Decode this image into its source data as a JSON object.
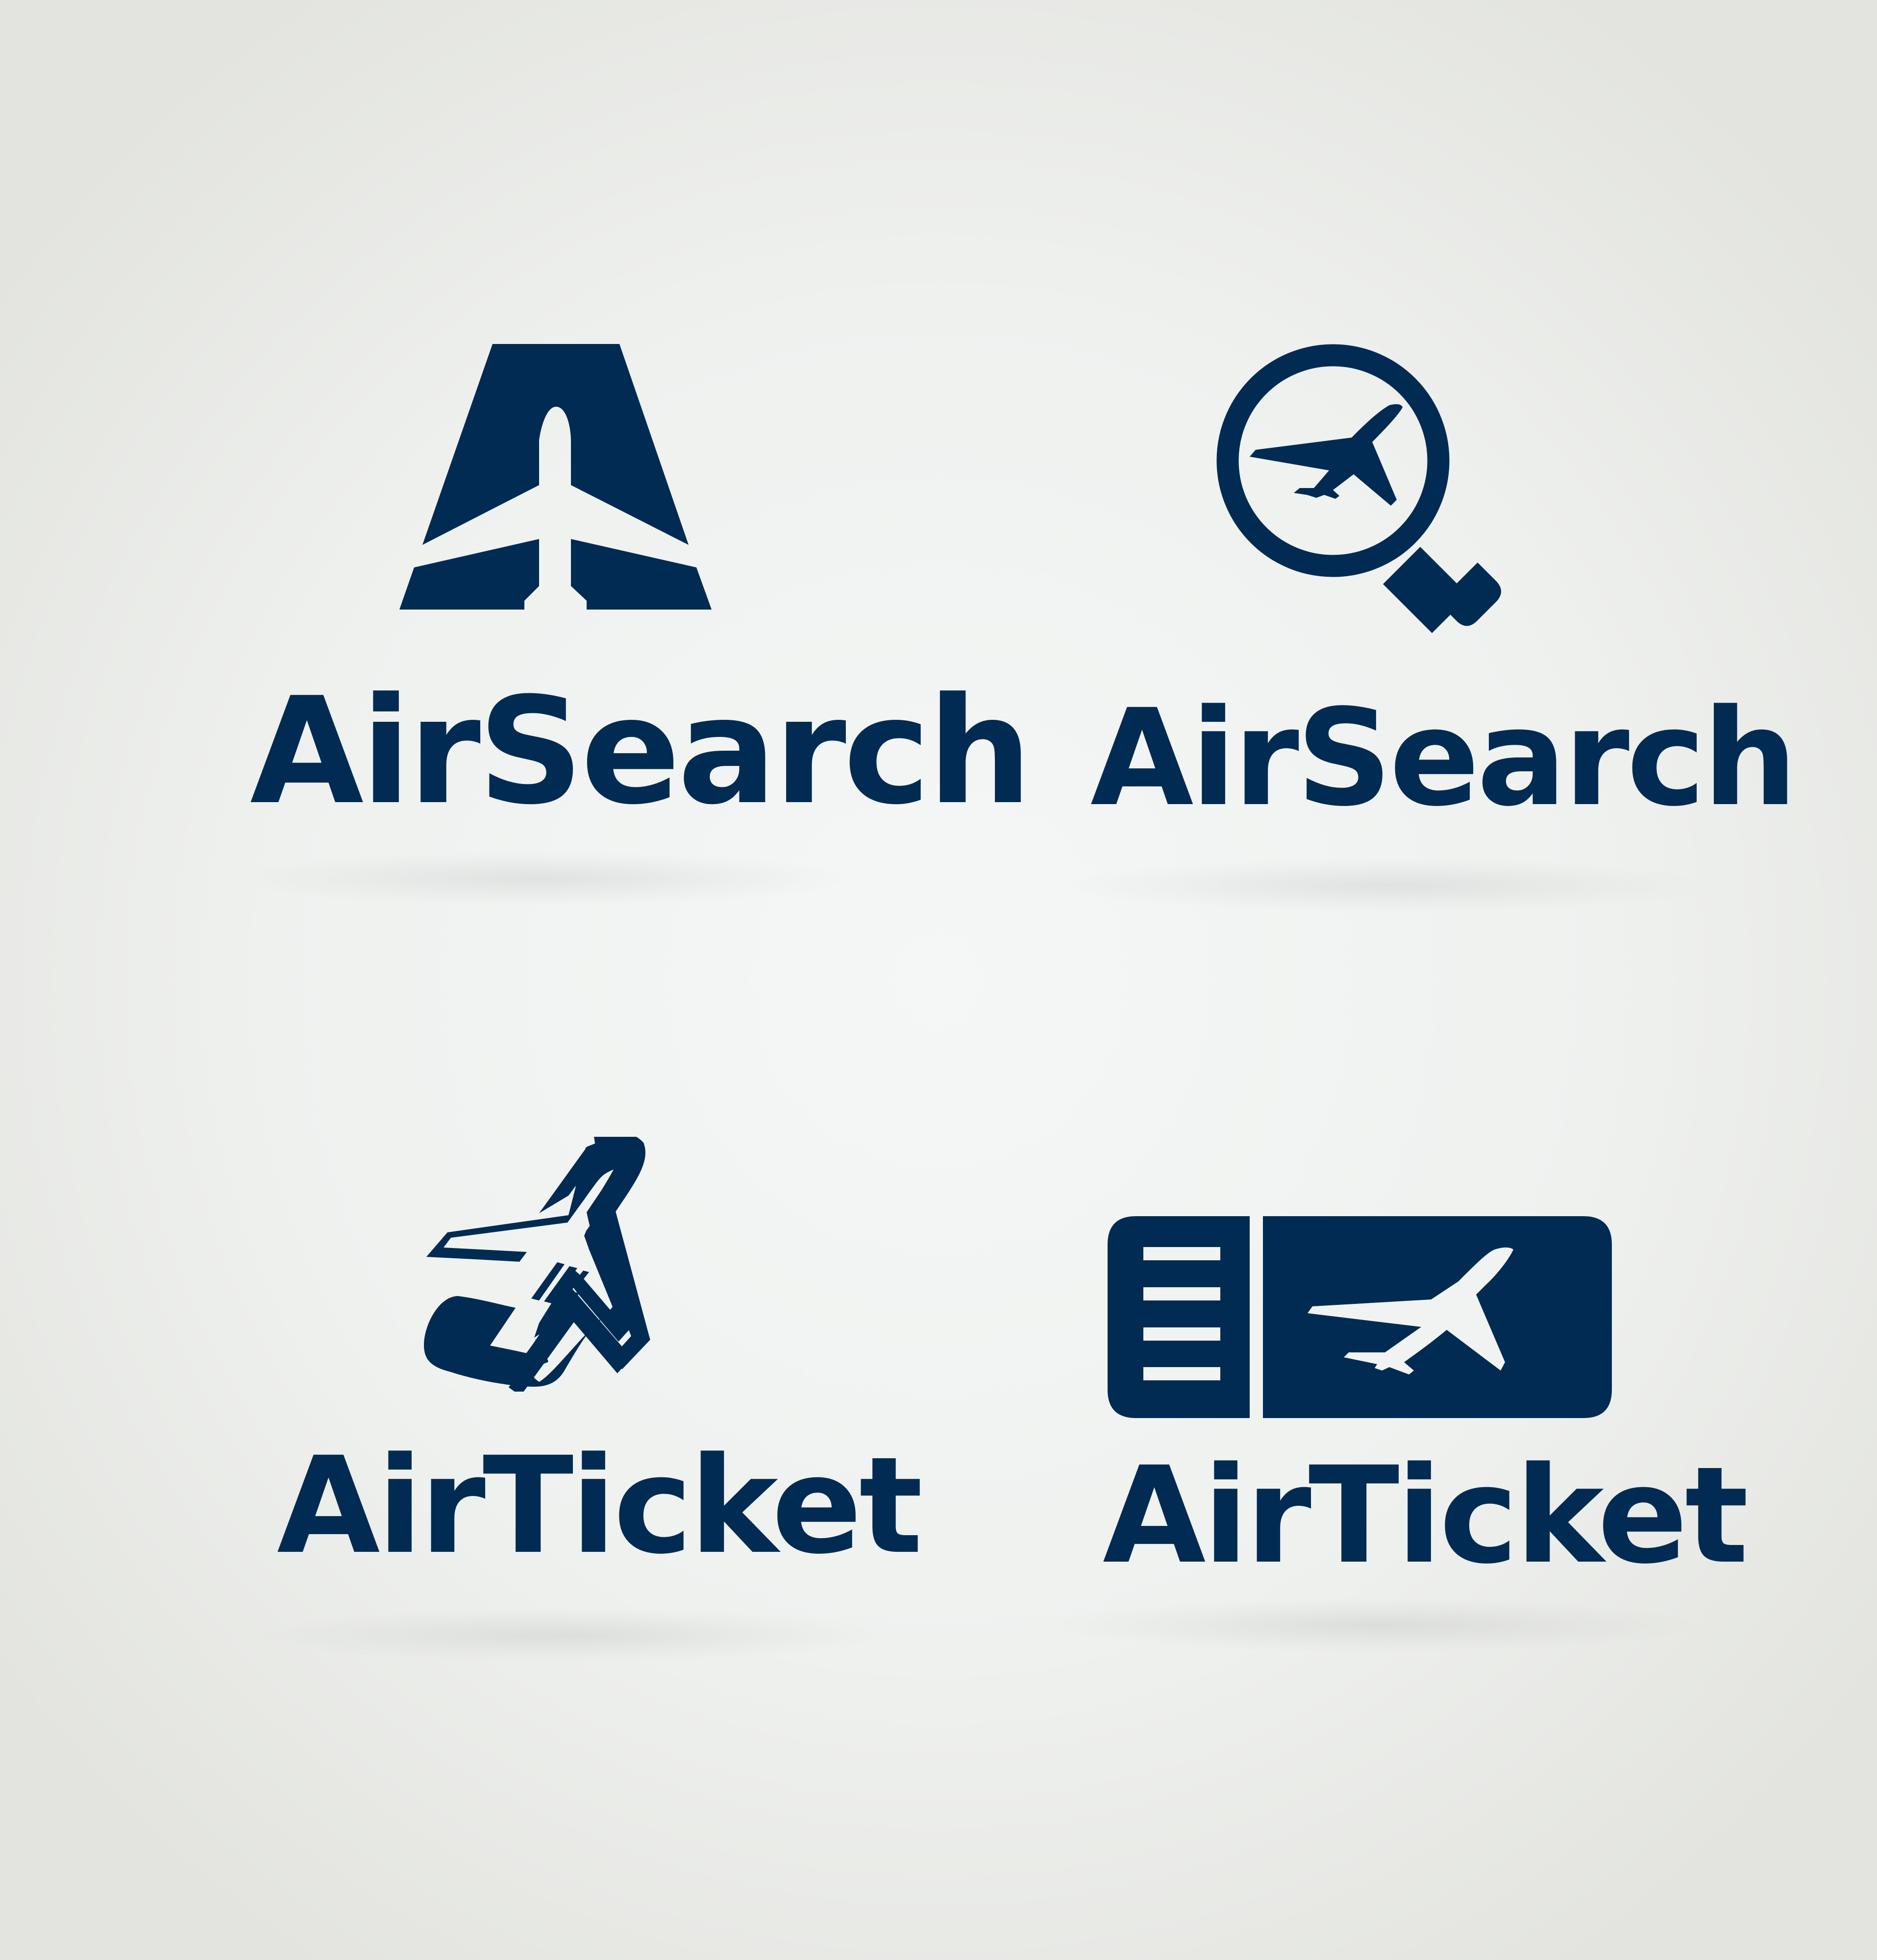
{
  "brand_color": "#012b52",
  "background_color": "#eff1ef",
  "logos": [
    {
      "wordmark": "AirSearch",
      "icon": "plane-letter-a-icon"
    },
    {
      "wordmark": "AirSearch",
      "icon": "magnifier-plane-icon"
    },
    {
      "wordmark": "AirTicket",
      "icon": "plane-ticket-roll-icon"
    },
    {
      "wordmark": "AirTicket",
      "icon": "boarding-pass-plane-icon"
    }
  ]
}
